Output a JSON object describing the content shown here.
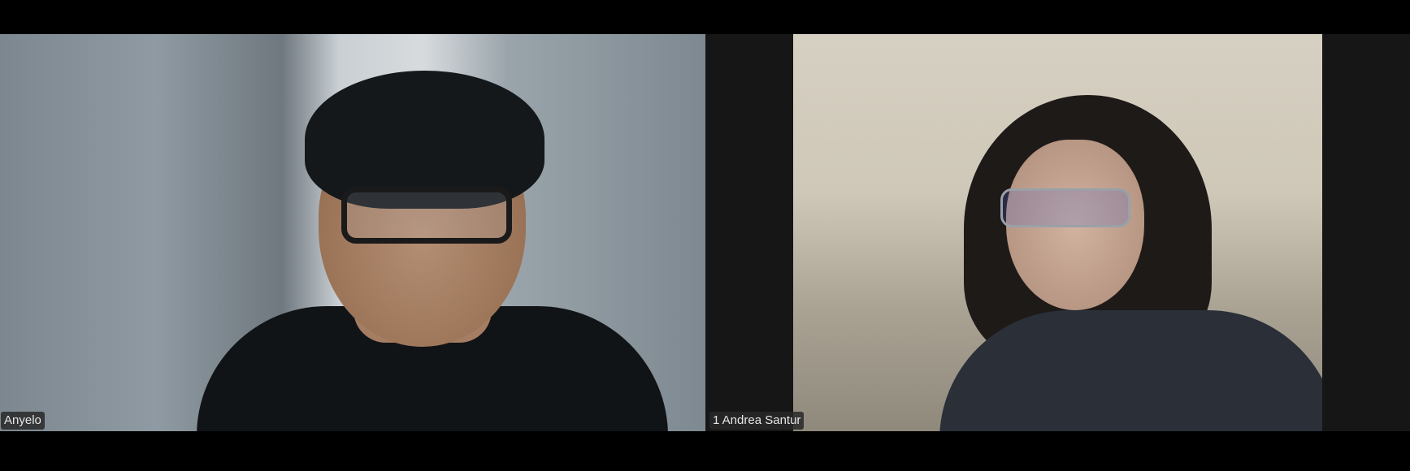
{
  "participants": [
    {
      "name": "Anyelo"
    },
    {
      "name": "1 Andrea Santur"
    }
  ]
}
